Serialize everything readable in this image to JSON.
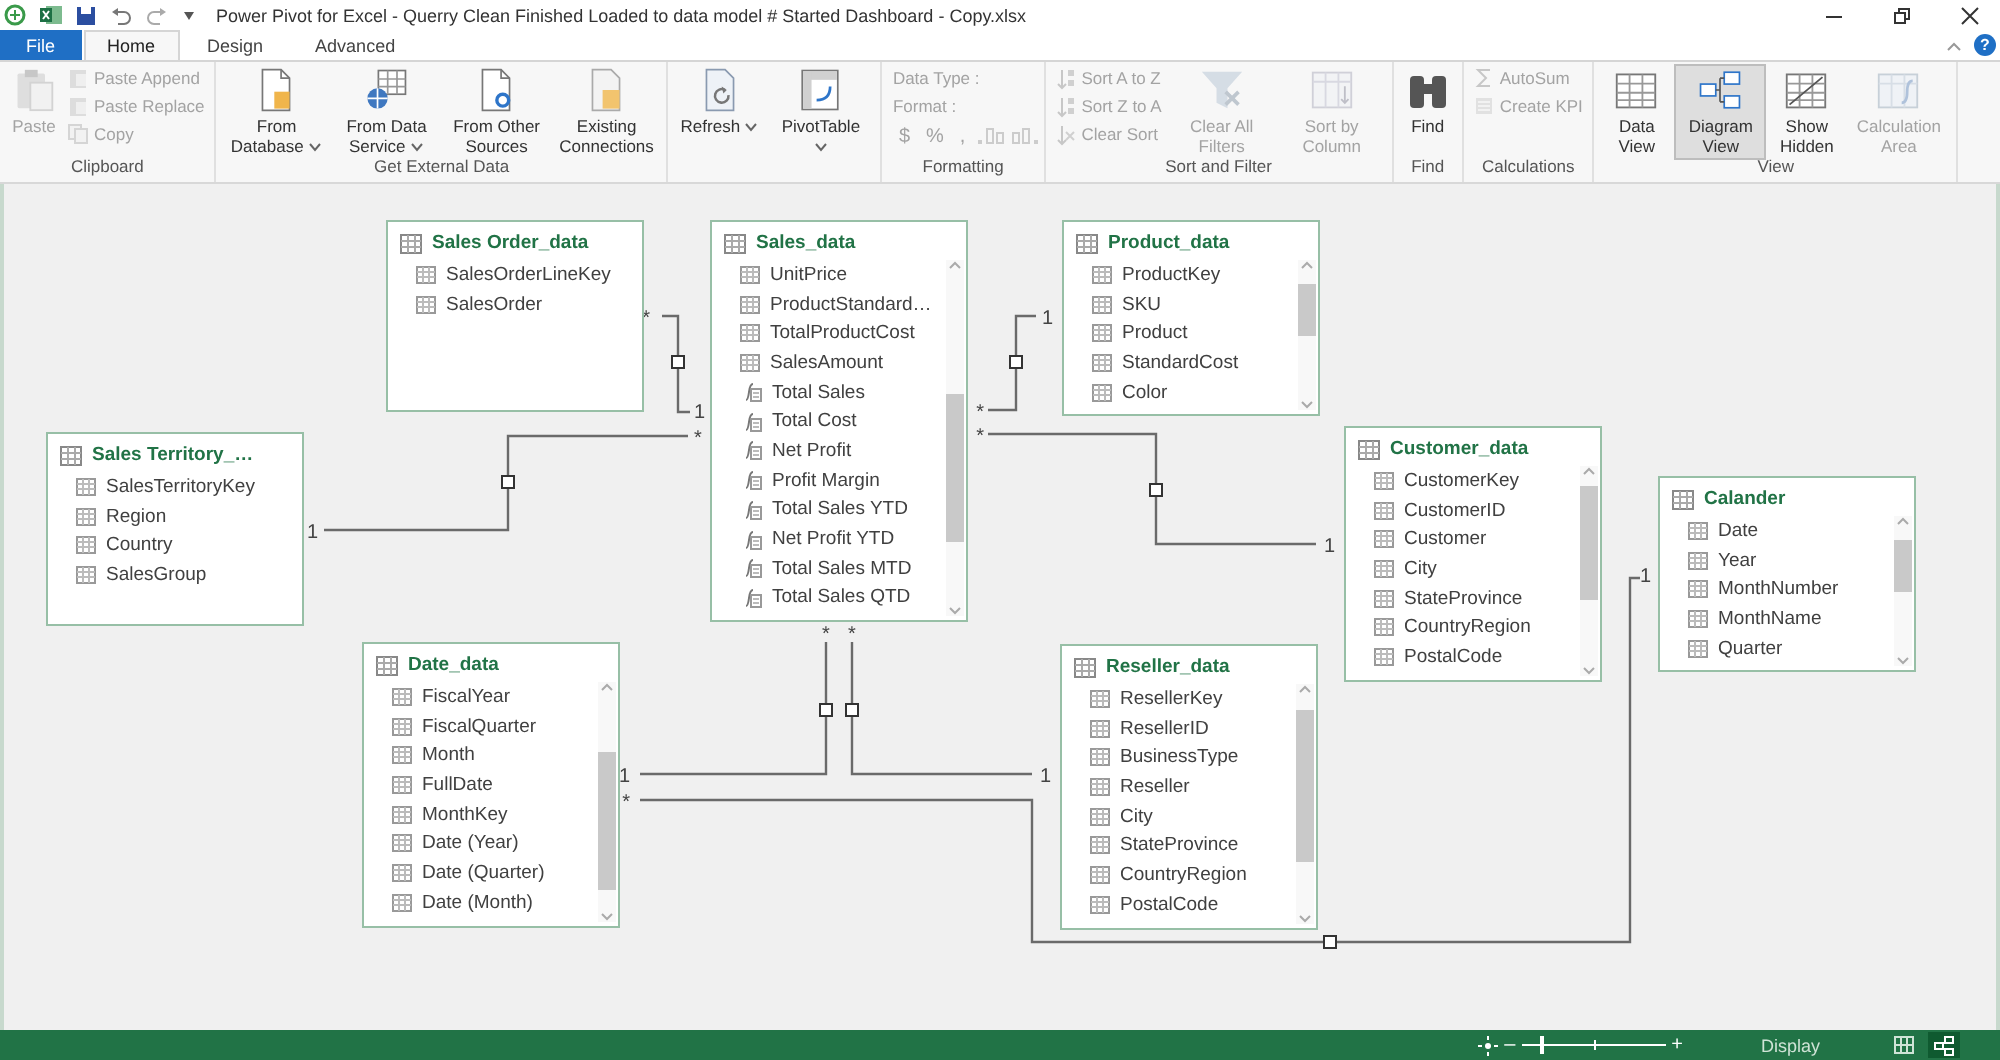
{
  "window": {
    "title": "Power Pivot for Excel - Querry Clean Finished Loaded to data model # Started Dashboard - Copy.xlsx",
    "help_label": "?"
  },
  "tabs": [
    {
      "label": "File",
      "kind": "file",
      "selected": false
    },
    {
      "label": "Home",
      "kind": "tab",
      "selected": true
    },
    {
      "label": "Design",
      "kind": "tab",
      "selected": false
    },
    {
      "label": "Advanced",
      "kind": "tab",
      "selected": false
    }
  ],
  "ribbon": {
    "groups": [
      {
        "label": "Clipboard",
        "items": [
          {
            "label": "Paste",
            "kind": "large",
            "disabled": true
          },
          {
            "label": "Paste Append",
            "kind": "small",
            "disabled": true
          },
          {
            "label": "Paste Replace",
            "kind": "small",
            "disabled": true
          },
          {
            "label": "Copy",
            "kind": "small",
            "disabled": true
          }
        ]
      },
      {
        "label": "Get External Data",
        "items": [
          {
            "label": "From Database",
            "kind": "large",
            "dropdown": true,
            "disabled": false
          },
          {
            "label": "From Data Service",
            "kind": "large",
            "dropdown": true,
            "disabled": false
          },
          {
            "label": "From Other Sources",
            "kind": "large",
            "disabled": false
          },
          {
            "label": "Existing Connections",
            "kind": "large",
            "disabled": false
          }
        ]
      },
      {
        "items": [
          {
            "label": "Refresh",
            "kind": "large",
            "dropdown": true,
            "disabled": false
          },
          {
            "label": "PivotTable",
            "kind": "large",
            "dropdown": true,
            "disabled": false
          }
        ]
      },
      {
        "label": "Formatting",
        "items": [
          {
            "label": "Data Type :",
            "kind": "field_label",
            "disabled": true
          },
          {
            "label": "Format :",
            "kind": "field_label",
            "disabled": true
          },
          {
            "label": "$",
            "kind": "symbol",
            "disabled": true
          },
          {
            "label": "%",
            "kind": "symbol",
            "disabled": true
          },
          {
            "label": ",",
            "kind": "symbol",
            "disabled": true
          },
          {
            "kind": "increase_decimal",
            "disabled": true
          },
          {
            "kind": "decrease_decimal",
            "disabled": true
          }
        ]
      },
      {
        "label": "Sort and Filter",
        "items": [
          {
            "label": "Sort A to Z",
            "kind": "small",
            "disabled": true
          },
          {
            "label": "Sort Z to A",
            "kind": "small",
            "disabled": true
          },
          {
            "label": "Clear Sort",
            "kind": "small",
            "disabled": true
          },
          {
            "label": "Clear All Filters",
            "kind": "large",
            "disabled": true
          },
          {
            "label": "Sort by Column",
            "kind": "large",
            "disabled": true
          }
        ]
      },
      {
        "label": "Find",
        "items": [
          {
            "label": "Find",
            "kind": "large",
            "disabled": false
          }
        ]
      },
      {
        "label": "Calculations",
        "items": [
          {
            "label": "AutoSum",
            "kind": "small",
            "disabled": true
          },
          {
            "label": "Create KPI",
            "kind": "small",
            "disabled": true
          }
        ]
      },
      {
        "label": "View",
        "items": [
          {
            "label": "Data View",
            "kind": "large",
            "disabled": false,
            "selected": false
          },
          {
            "label": "Diagram View",
            "kind": "large",
            "disabled": false,
            "selected": true
          },
          {
            "label": "Show Hidden",
            "kind": "large",
            "disabled": false,
            "selected": false
          },
          {
            "label": "Calculation Area",
            "kind": "large",
            "disabled": true,
            "selected": false
          }
        ]
      }
    ]
  },
  "diagram": {
    "tables": [
      {
        "title": "Sales Order_data",
        "scrollbar": false,
        "fields": [
          {
            "name": "SalesOrderLineKey",
            "kind": "column"
          },
          {
            "name": "SalesOrder",
            "kind": "column"
          }
        ]
      },
      {
        "title": "Sales_data",
        "scrollbar": true,
        "fields": [
          {
            "name": "UnitPrice",
            "kind": "column"
          },
          {
            "name": "ProductStandard…",
            "kind": "column"
          },
          {
            "name": "TotalProductCost",
            "kind": "column"
          },
          {
            "name": "SalesAmount",
            "kind": "column"
          },
          {
            "name": "Total Sales",
            "kind": "measure"
          },
          {
            "name": "Total Cost",
            "kind": "measure"
          },
          {
            "name": "Net Profit",
            "kind": "measure"
          },
          {
            "name": "Profit Margin",
            "kind": "measure"
          },
          {
            "name": "Total Sales YTD",
            "kind": "measure"
          },
          {
            "name": "Net Profit YTD",
            "kind": "measure"
          },
          {
            "name": "Total Sales MTD",
            "kind": "measure"
          },
          {
            "name": "Total Sales QTD",
            "kind": "measure"
          }
        ]
      },
      {
        "title": "Product_data",
        "scrollbar": true,
        "fields": [
          {
            "name": "ProductKey",
            "kind": "column"
          },
          {
            "name": "SKU",
            "kind": "column"
          },
          {
            "name": "Product",
            "kind": "column"
          },
          {
            "name": "StandardCost",
            "kind": "column"
          },
          {
            "name": "Color",
            "kind": "column"
          }
        ]
      },
      {
        "title": "Sales Territory_…",
        "scrollbar": false,
        "fields": [
          {
            "name": "SalesTerritoryKey",
            "kind": "column"
          },
          {
            "name": "Region",
            "kind": "column"
          },
          {
            "name": "Country",
            "kind": "column"
          },
          {
            "name": "SalesGroup",
            "kind": "column"
          }
        ]
      },
      {
        "title": "Customer_data",
        "scrollbar": true,
        "fields": [
          {
            "name": "CustomerKey",
            "kind": "column"
          },
          {
            "name": "CustomerID",
            "kind": "column"
          },
          {
            "name": "Customer",
            "kind": "column"
          },
          {
            "name": "City",
            "kind": "column"
          },
          {
            "name": "StateProvince",
            "kind": "column"
          },
          {
            "name": "CountryRegion",
            "kind": "column"
          },
          {
            "name": "PostalCode",
            "kind": "column"
          }
        ]
      },
      {
        "title": "Calander",
        "scrollbar": true,
        "fields": [
          {
            "name": "Date",
            "kind": "column"
          },
          {
            "name": "Year",
            "kind": "column"
          },
          {
            "name": "MonthNumber",
            "kind": "column"
          },
          {
            "name": "MonthName",
            "kind": "column"
          },
          {
            "name": "Quarter",
            "kind": "column"
          }
        ]
      },
      {
        "title": "Date_data",
        "scrollbar": true,
        "fields": [
          {
            "name": "FiscalYear",
            "kind": "column"
          },
          {
            "name": "FiscalQuarter",
            "kind": "column"
          },
          {
            "name": "Month",
            "kind": "column"
          },
          {
            "name": "FullDate",
            "kind": "column"
          },
          {
            "name": "MonthKey",
            "kind": "column"
          },
          {
            "name": "Date (Year)",
            "kind": "column"
          },
          {
            "name": "Date (Quarter)",
            "kind": "column"
          },
          {
            "name": "Date (Month)",
            "kind": "column"
          }
        ]
      },
      {
        "title": "Reseller_data",
        "scrollbar": true,
        "fields": [
          {
            "name": "ResellerKey",
            "kind": "column"
          },
          {
            "name": "ResellerID",
            "kind": "column"
          },
          {
            "name": "BusinessType",
            "kind": "column"
          },
          {
            "name": "Reseller",
            "kind": "column"
          },
          {
            "name": "City",
            "kind": "column"
          },
          {
            "name": "StateProvince",
            "kind": "column"
          },
          {
            "name": "CountryRegion",
            "kind": "column"
          },
          {
            "name": "PostalCode",
            "kind": "column"
          }
        ]
      }
    ],
    "relationships": [
      {
        "from_cardinality": "*",
        "to_cardinality": "1"
      },
      {
        "from_cardinality": "1",
        "to_cardinality": "*"
      },
      {
        "from_cardinality": "*",
        "to_cardinality": "1"
      },
      {
        "from_cardinality": "*",
        "to_cardinality": "1"
      },
      {
        "from_cardinality": "*",
        "to_cardinality": "1"
      },
      {
        "from_cardinality": "*",
        "to_cardinality": "1"
      },
      {
        "from_cardinality": "*",
        "to_cardinality": "1"
      }
    ]
  },
  "status_bar": {
    "zoom": {
      "level": 0.14,
      "zoom_out_label": "–",
      "zoom_in_label": "+"
    },
    "display_label": "Display",
    "views": [
      {
        "kind": "grid",
        "selected": false
      },
      {
        "kind": "diagram",
        "selected": true
      }
    ]
  }
}
